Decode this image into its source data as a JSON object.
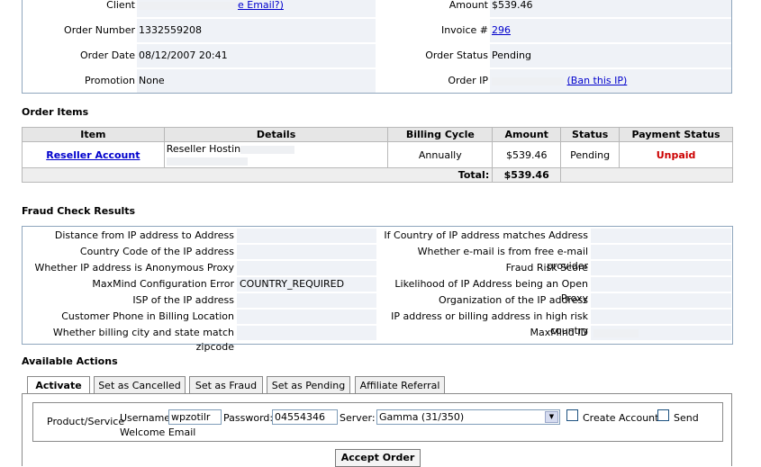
{
  "summary": {
    "client_label": "Client",
    "client_link": "e Email?)",
    "amount_label": "Amount",
    "amount_value": "$539.46",
    "order_number_label": "Order Number",
    "order_number_value": "1332559208",
    "invoice_label": "Invoice #",
    "invoice_value": "296",
    "order_date_label": "Order Date",
    "order_date_value": "08/12/2007 20:41",
    "order_status_label": "Order Status",
    "order_status_value": "Pending",
    "promotion_label": "Promotion",
    "promotion_value": "None",
    "order_ip_label": "Order IP",
    "ban_ip_link": "(Ban this IP)"
  },
  "order_items": {
    "title": "Order Items",
    "headers": [
      "Item",
      "Details",
      "Billing Cycle",
      "Amount",
      "Status",
      "Payment Status"
    ],
    "row": {
      "item": "Reseller Account",
      "details": "Reseller Hostin",
      "billing_cycle": "Annually",
      "amount": "$539.46",
      "status": "Pending",
      "payment_status": "Unpaid"
    },
    "total_label": "Total:",
    "total_value": "$539.46"
  },
  "fraud": {
    "title": "Fraud Check Results",
    "left": [
      {
        "label": "Distance from IP address to Address",
        "value": ""
      },
      {
        "label": "Country Code of the IP address",
        "value": ""
      },
      {
        "label": "Whether IP address is Anonymous Proxy",
        "value": ""
      },
      {
        "label": "MaxMind Configuration Error",
        "value": "COUNTRY_REQUIRED"
      },
      {
        "label": "ISP of the IP address",
        "value": ""
      },
      {
        "label": "Customer Phone in Billing Location",
        "value": ""
      },
      {
        "label": "Whether billing city and state match zipcode",
        "value": ""
      }
    ],
    "right": [
      {
        "label": "If Country of IP address matches Address",
        "value": ""
      },
      {
        "label": "Whether e-mail is from free e-mail provider",
        "value": ""
      },
      {
        "label": "Fraud Risk Score",
        "value": ""
      },
      {
        "label": "Likelihood of IP Address being an Open Proxy",
        "value": ""
      },
      {
        "label": "Organization of the IP address",
        "value": ""
      },
      {
        "label": "IP address or billing address in high risk country",
        "value": ""
      },
      {
        "label": "MaxMind ID",
        "value": ""
      }
    ]
  },
  "actions": {
    "title": "Available Actions",
    "tabs": [
      "Activate",
      "Set as Cancelled",
      "Set as Fraud",
      "Set as Pending",
      "Affiliate Referral"
    ],
    "product_service_label": "Product/Service",
    "username_label": "Username:",
    "username_value": "wpzotilr",
    "password_label": "Password:",
    "password_value": "04554346",
    "server_label": "Server:",
    "server_value": "Gamma (31/350)",
    "create_account_label": "Create Account",
    "send_label": "Send",
    "welcome_email_label": "Welcome Email",
    "accept_button": "Accept Order"
  },
  "colors": {
    "border_blue": "#8fa6bd",
    "value_bg": "#eff2f7",
    "link": "#0000cc",
    "unpaid": "#cc0000"
  }
}
